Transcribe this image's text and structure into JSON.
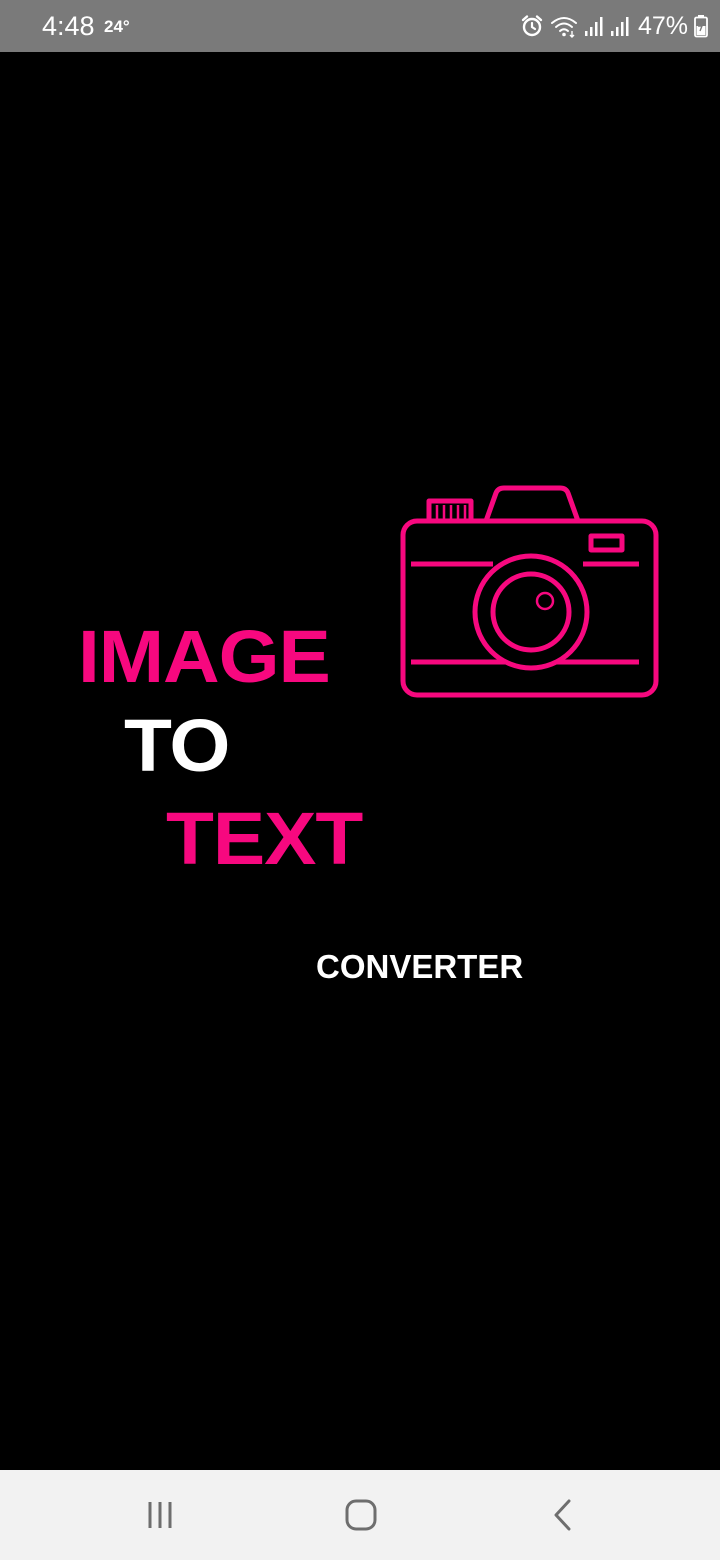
{
  "status_bar": {
    "time": "4:48",
    "temperature": "24°",
    "battery_percent": "47%",
    "icons": [
      "alarm-icon",
      "wifi-icon",
      "signal-icon",
      "signal-icon",
      "battery-icon"
    ]
  },
  "splash": {
    "line1": "IMAGE",
    "line2": "TO",
    "line3": "TEXT",
    "line4": "CONVERTER",
    "accent_color": "#f7087f",
    "text_color": "#ffffff",
    "background_color": "#000000",
    "logo_icon": "camera-icon"
  },
  "nav_bar": {
    "buttons": [
      "recents-icon",
      "home-icon",
      "back-icon"
    ]
  }
}
